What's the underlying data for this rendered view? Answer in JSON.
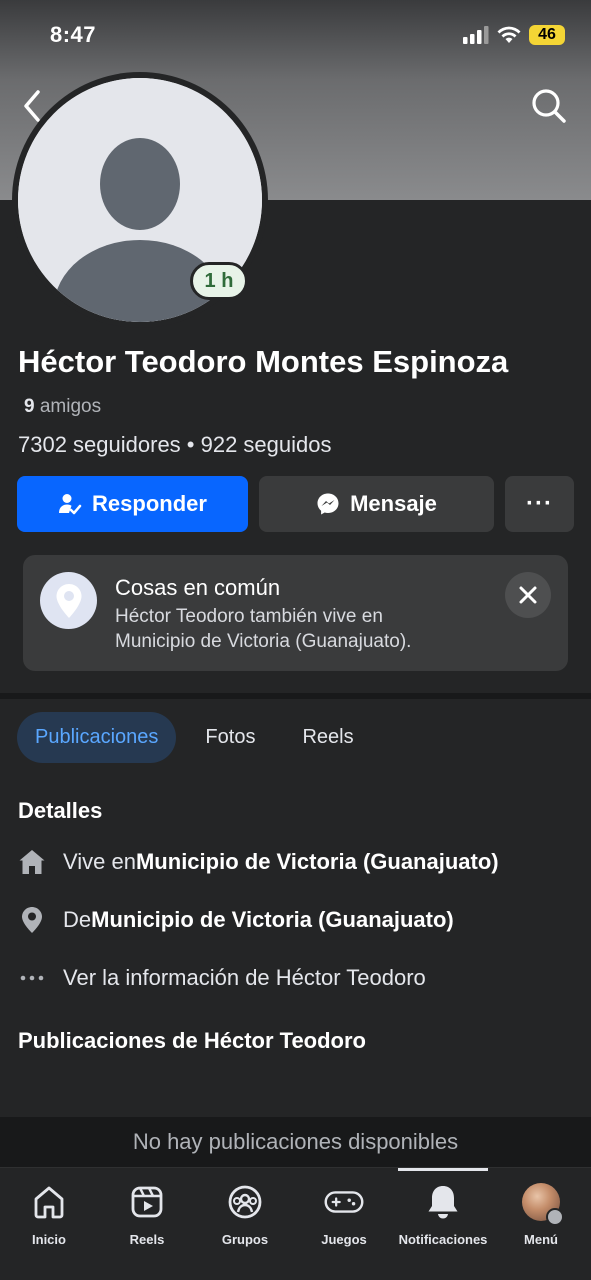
{
  "status_bar": {
    "time": "8:47",
    "battery": "46"
  },
  "profile": {
    "badge": "1 h",
    "name": "Héctor Teodoro Montes Espinoza",
    "friends_count": "9",
    "friends_label": "amigos",
    "followers_line": "7302 seguidores • 922 seguidos"
  },
  "actions": {
    "respond_label": "Responder",
    "message_label": "Mensaje",
    "more_label": "···"
  },
  "common": {
    "title": "Cosas en común",
    "line1": "Héctor Teodoro también vive en",
    "line2": "Municipio de Victoria (Guanajuato)."
  },
  "tabs": [
    {
      "label": "Publicaciones",
      "active": true
    },
    {
      "label": "Fotos",
      "active": false
    },
    {
      "label": "Reels",
      "active": false
    }
  ],
  "details": {
    "title": "Detalles",
    "lives_prefix": "Vive en ",
    "lives_place": "Municipio de Victoria (Guanajuato)",
    "from_prefix": "De ",
    "from_place": "Municipio de Victoria (Guanajuato)",
    "see_info": "Ver la información de Héctor Teodoro"
  },
  "posts": {
    "title": "Publicaciones de Héctor Teodoro",
    "empty": "No hay publicaciones disponibles"
  },
  "nav": [
    {
      "label": "Inicio",
      "icon": "home-icon"
    },
    {
      "label": "Reels",
      "icon": "reels-icon"
    },
    {
      "label": "Grupos",
      "icon": "groups-icon"
    },
    {
      "label": "Juegos",
      "icon": "gamepad-icon"
    },
    {
      "label": "Notificaciones",
      "icon": "bell-icon"
    },
    {
      "label": "Menú",
      "icon": "avatar"
    }
  ],
  "colors": {
    "accent": "#0866ff",
    "background": "#242526",
    "card": "#3a3b3c",
    "active_tab": "#263951"
  }
}
